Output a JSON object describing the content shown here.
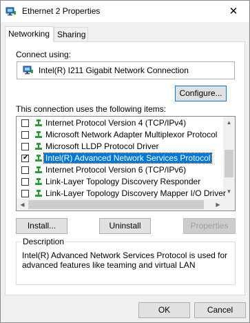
{
  "window": {
    "title": "Ethernet 2 Properties",
    "close_glyph": "✕"
  },
  "tabs": [
    {
      "label": "Networking"
    },
    {
      "label": "Sharing"
    }
  ],
  "connect_using": {
    "label": "Connect using:",
    "adapter_name": "Intel(R) I211 Gigabit Network Connection",
    "configure_button": "Configure..."
  },
  "items_label": "This connection uses the following items:",
  "items": [
    {
      "label": "Internet Protocol Version 4 (TCP/IPv4)",
      "checked": false
    },
    {
      "label": "Microsoft Network Adapter Multiplexor Protocol",
      "checked": false
    },
    {
      "label": "Microsoft LLDP Protocol Driver",
      "checked": false
    },
    {
      "label": "Intel(R) Advanced Network Services Protocol",
      "checked": true,
      "selected": true
    },
    {
      "label": "Internet Protocol Version 6 (TCP/IPv6)",
      "checked": false
    },
    {
      "label": "Link-Layer Topology Discovery Responder",
      "checked": false
    },
    {
      "label": "Link-Layer Topology Discovery Mapper I/O Driver",
      "checked": false
    }
  ],
  "buttons": {
    "install": "Install...",
    "uninstall": "Uninstall",
    "properties": "Properties"
  },
  "description": {
    "title": "Description",
    "text": "Intel(R) Advanced Network Services Protocol is used for advanced features like teaming and virtual LAN"
  },
  "footer": {
    "ok": "OK",
    "cancel": "Cancel"
  },
  "colors": {
    "selection": "#0078d7",
    "focus_border": "#0078d7",
    "icon_green": "#2e9b3b"
  }
}
